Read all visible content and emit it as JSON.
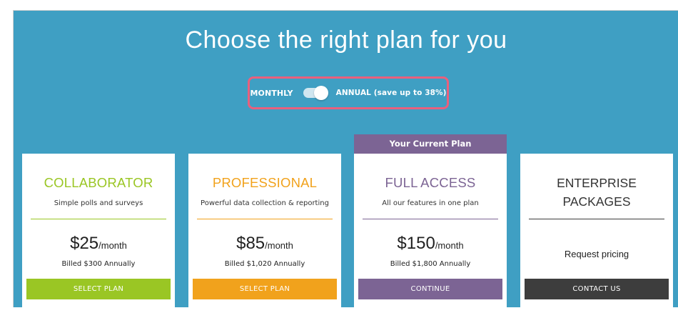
{
  "header": {
    "title": "Choose the right plan for you"
  },
  "billing_toggle": {
    "monthly_label": "MONTHLY",
    "annual_label": "ANNUAL (save up to 38%)",
    "selected": "annual"
  },
  "current_plan_banner": "Your Current Plan",
  "plans": [
    {
      "name": "COLLABORATOR",
      "subtitle": "Simple polls and surveys",
      "price": "$25",
      "per": "/month",
      "billed": "Billed $300 Annually",
      "cta": "SELECT PLAN",
      "accent": "#9ac624"
    },
    {
      "name": "PROFESSIONAL",
      "subtitle": "Powerful data collection & reporting",
      "price": "$85",
      "per": "/month",
      "billed": "Billed $1,020 Annually",
      "cta": "SELECT PLAN",
      "accent": "#f1a21c"
    },
    {
      "name": "FULL ACCESS",
      "subtitle": "All our features in one plan",
      "price": "$150",
      "per": "/month",
      "billed": "Billed $1,800 Annually",
      "cta": "CONTINUE",
      "accent": "#7c6494"
    },
    {
      "name_line1": "ENTERPRISE",
      "name_line2": "PACKAGES",
      "request": "Request pricing",
      "cta": "CONTACT US",
      "accent": "#3d3d3d"
    }
  ],
  "colors": {
    "background": "#3f9fc3",
    "highlight_border": "#e9607d",
    "text_dark": "#222222"
  }
}
